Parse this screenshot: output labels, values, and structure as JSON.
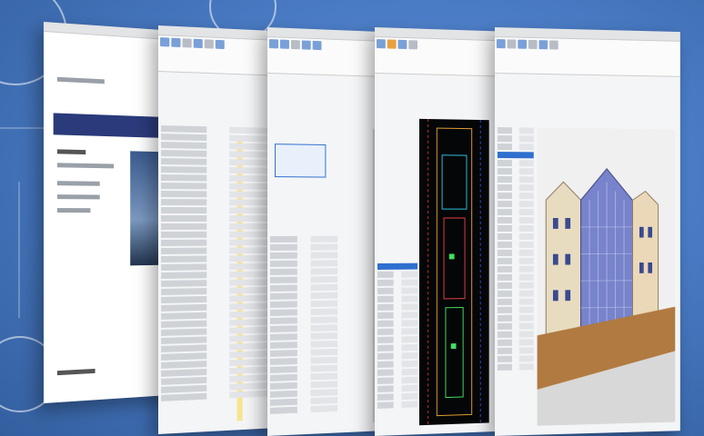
{
  "scene": {
    "background_color": "#4a7cc6",
    "accent_color": "#2f6fcf"
  },
  "windows": [
    {
      "name": "document-preview-window"
    },
    {
      "name": "schedule-table-window"
    },
    {
      "name": "parameter-tree-window"
    },
    {
      "name": "cad-plan-window"
    },
    {
      "name": "3d-building-render-window"
    }
  ]
}
